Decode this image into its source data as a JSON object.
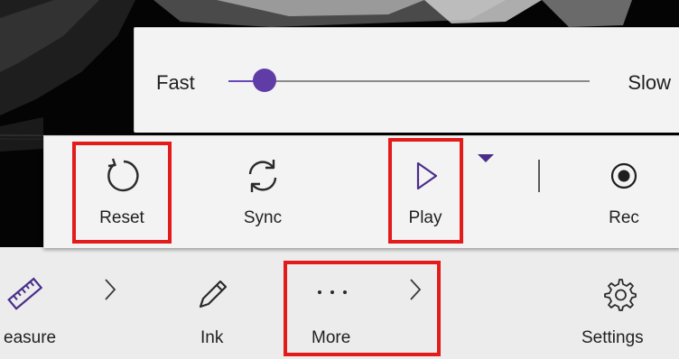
{
  "speed": {
    "fast_label": "Fast",
    "slow_label": "Slow",
    "value_fraction": 0.1
  },
  "playback": {
    "reset_label": "Reset",
    "sync_label": "Sync",
    "play_label": "Play",
    "rec_label": "Rec"
  },
  "commands": {
    "measure_label": "easure",
    "ink_label": "Ink",
    "more_label": "More",
    "settings_label": "Settings"
  },
  "colors": {
    "accent": "#5f3ca6",
    "highlight": "#e31b1b",
    "toolbar_bg": "#f3f3f3"
  },
  "icons": {
    "reset": "refresh-icon",
    "sync": "sync-icon",
    "play": "play-icon",
    "rec": "record-icon",
    "measure": "ruler-icon",
    "ink": "pencil-icon",
    "more": "more-dots-icon",
    "settings": "gear-icon"
  }
}
